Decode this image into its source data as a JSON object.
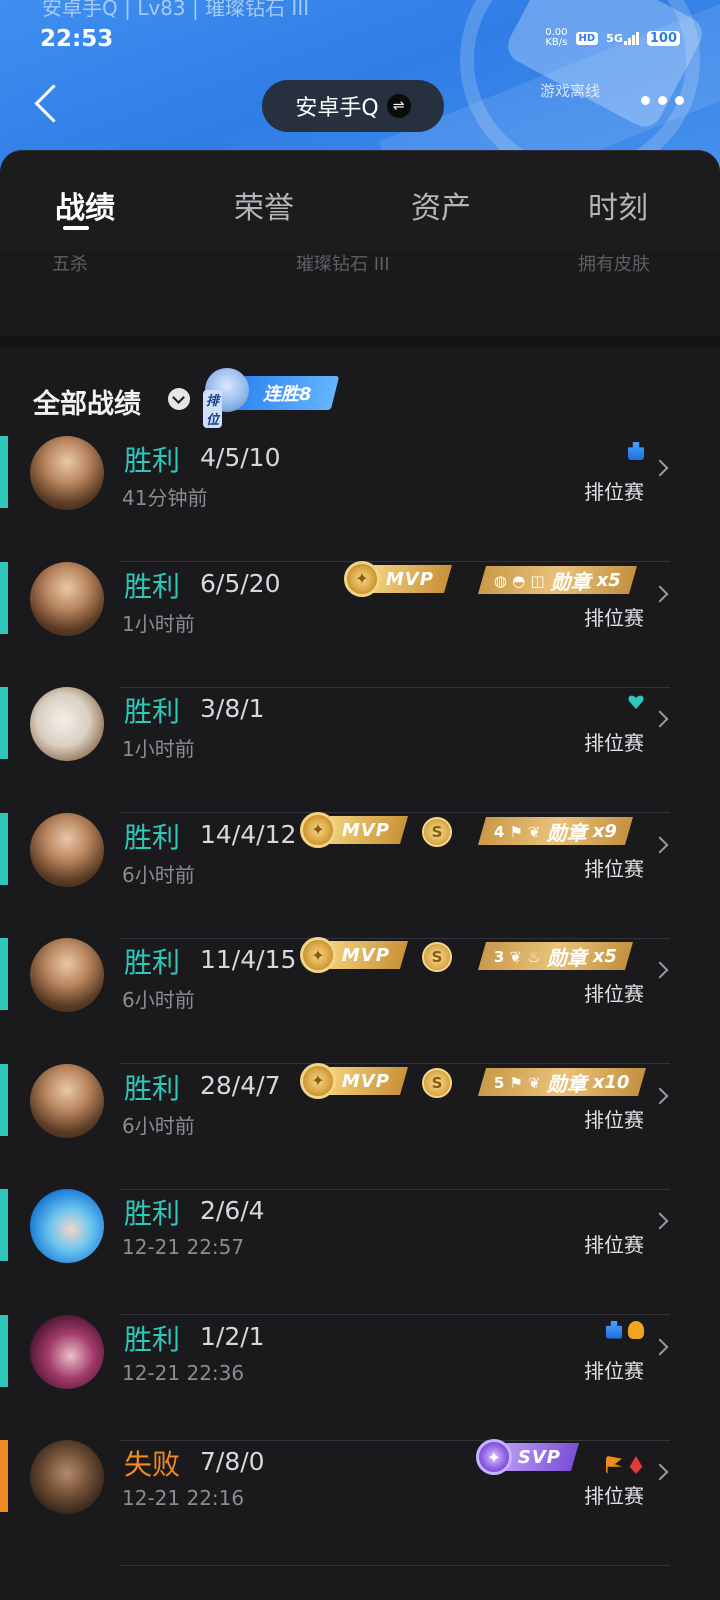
{
  "header": {
    "subtitle": "安卓手Q | Lv83 | 璀璨钻石 III",
    "time": "22:53",
    "net_speed_top": "0.00",
    "net_speed_unit": "KB/s",
    "hd": "HD",
    "network": "5G",
    "battery": "100",
    "offline_label": "游戏离线",
    "account_name": "安卓手Q",
    "colors": {
      "header_blue": "#2f7de6",
      "win_teal": "#2fc7bb",
      "loss_orange": "#f08a24"
    }
  },
  "tabs": [
    "战绩",
    "荣誉",
    "资产",
    "时刻"
  ],
  "stat_strip": {
    "left": "五杀",
    "center": "璀璨钻石 III",
    "right": "拥有皮肤"
  },
  "list": {
    "title": "全部战绩",
    "streak_tag": "排位",
    "streak_text": "连胜8"
  },
  "matches": [
    {
      "result": "胜利",
      "kda": "4/5/10",
      "time": "41分钟前",
      "mode": "排位赛",
      "win": true,
      "hero": "mage-gold",
      "icons": [
        "blue"
      ]
    },
    {
      "result": "胜利",
      "kda": "6/5/20",
      "time": "1小时前",
      "mode": "排位赛",
      "win": true,
      "hero": "mage-gold",
      "mvp": "MVP",
      "medal": {
        "icons": "◍ ◓ ◫",
        "label": "勋章",
        "count": "x5"
      }
    },
    {
      "result": "胜利",
      "kda": "3/8/1",
      "time": "1小时前",
      "mode": "排位赛",
      "win": true,
      "hero": "white-mask",
      "icons": [
        "teal"
      ]
    },
    {
      "result": "胜利",
      "kda": "14/4/12",
      "time": "6小时前",
      "mode": "排位赛",
      "win": true,
      "hero": "mage-gold",
      "mvp": "MVP",
      "coin": "S",
      "medal": {
        "icons": "4 ⚑ ❦",
        "label": "勋章",
        "count": "x9"
      }
    },
    {
      "result": "胜利",
      "kda": "11/4/15",
      "time": "6小时前",
      "mode": "排位赛",
      "win": true,
      "hero": "mage-gold",
      "mvp": "MVP",
      "coin": "S",
      "medal": {
        "icons": "3 ❦ ♨",
        "label": "勋章",
        "count": "x5"
      }
    },
    {
      "result": "胜利",
      "kda": "28/4/7",
      "time": "6小时前",
      "mode": "排位赛",
      "win": true,
      "hero": "mage-gold",
      "mvp": "MVP",
      "coin": "S",
      "medal": {
        "icons": "5 ⚑ ❦",
        "label": "勋章",
        "count": "x10"
      }
    },
    {
      "result": "胜利",
      "kda": "2/6/4",
      "time": "12-21 22:57",
      "mode": "排位赛",
      "win": true,
      "hero": "blue-hair"
    },
    {
      "result": "胜利",
      "kda": "1/2/1",
      "time": "12-21 22:36",
      "mode": "排位赛",
      "win": true,
      "hero": "dark-rose",
      "icons": [
        "blue",
        "coin"
      ]
    },
    {
      "result": "失败",
      "kda": "7/8/0",
      "time": "12-21 22:16",
      "mode": "排位赛",
      "win": false,
      "hero": "bearded",
      "svp": "SVP",
      "icons": [
        "orange",
        "red"
      ]
    }
  ]
}
